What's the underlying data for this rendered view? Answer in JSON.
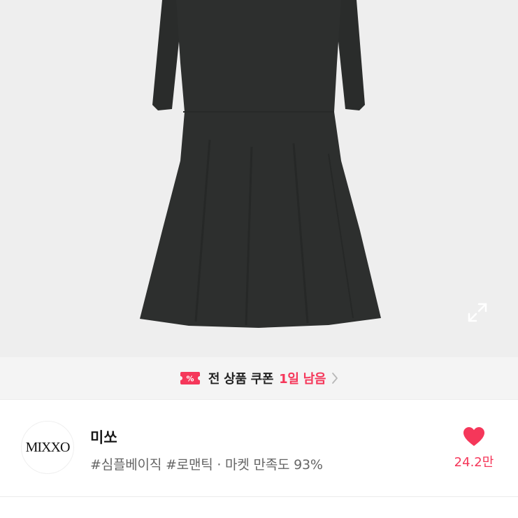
{
  "product": {
    "image_alt": "dress"
  },
  "icons": {
    "expand": "expand-icon",
    "coupon": "coupon-ticket-icon",
    "chevron": "chevron-right-icon",
    "heart": "heart-icon"
  },
  "coupon_bar": {
    "label": "전 상품 쿠폰",
    "time_left": "1일 남음"
  },
  "store": {
    "logo_text": "MIXXO",
    "name": "미쏘",
    "meta": "#심플베이직 #로맨틱 · 마켓 만족도 93%",
    "likes": "24.2만"
  },
  "colors": {
    "accent": "#f5375a",
    "image_bg": "#eeeeee",
    "dress": "#2b2d2c"
  }
}
